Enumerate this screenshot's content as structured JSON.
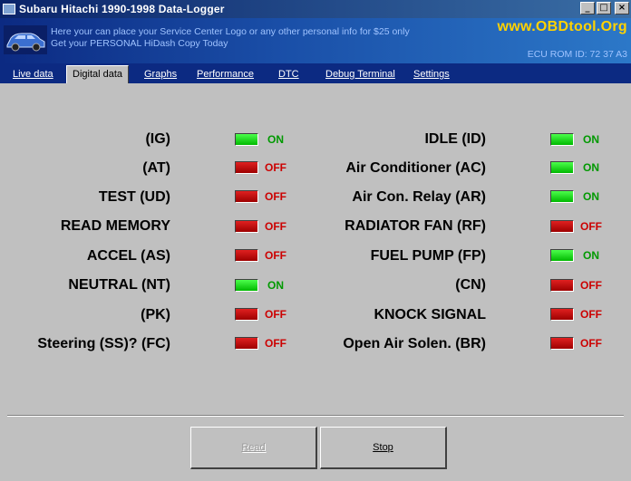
{
  "window": {
    "title": "Subaru Hitachi 1990-1998 Data-Logger",
    "minimize_glyph": "_",
    "maximize_glyph": "□",
    "close_glyph": "×"
  },
  "banner": {
    "line1": "Here your can place your Service Center Logo or any other personal info for $25 only",
    "line2": "Get your PERSONAL HiDash Copy Today",
    "brand": "www.OBDtool.Org",
    "ecu_rom": "ECU ROM ID: 72 37 A3"
  },
  "tabs": [
    {
      "label": "Live data",
      "active": false
    },
    {
      "label": "Digital data",
      "active": true
    },
    {
      "label": "Graphs",
      "active": false
    },
    {
      "label": "Performance",
      "active": false
    },
    {
      "label": "DTC",
      "active": false
    },
    {
      "label": "Debug Terminal",
      "active": false
    },
    {
      "label": "Settings",
      "active": false
    }
  ],
  "status_text": {
    "on": "ON",
    "off": "OFF"
  },
  "left_signals": [
    {
      "label": "(IG)",
      "state": "on"
    },
    {
      "label": "(AT)",
      "state": "off"
    },
    {
      "label": "TEST (UD)",
      "state": "off"
    },
    {
      "label": "READ MEMORY",
      "state": "off"
    },
    {
      "label": "ACCEL (AS)",
      "state": "off"
    },
    {
      "label": "NEUTRAL (NT)",
      "state": "on"
    },
    {
      "label": "(PK)",
      "state": "off"
    },
    {
      "label": "Steering (SS)? (FC)",
      "state": "off"
    }
  ],
  "right_signals": [
    {
      "label": "IDLE (ID)",
      "state": "on"
    },
    {
      "label": "Air Conditioner (AC)",
      "state": "on"
    },
    {
      "label": "Air Con. Relay (AR)",
      "state": "on"
    },
    {
      "label": "RADIATOR FAN (RF)",
      "state": "off"
    },
    {
      "label": "FUEL PUMP (FP)",
      "state": "on"
    },
    {
      "label": "(CN)",
      "state": "off"
    },
    {
      "label": "KNOCK SIGNAL",
      "state": "off"
    },
    {
      "label": "Open Air Solen. (BR)",
      "state": "off"
    }
  ],
  "buttons": {
    "read": "Read",
    "stop": "Stop"
  },
  "colors": {
    "on": "#00b800",
    "off": "#b00000",
    "brand": "#ffd200"
  }
}
